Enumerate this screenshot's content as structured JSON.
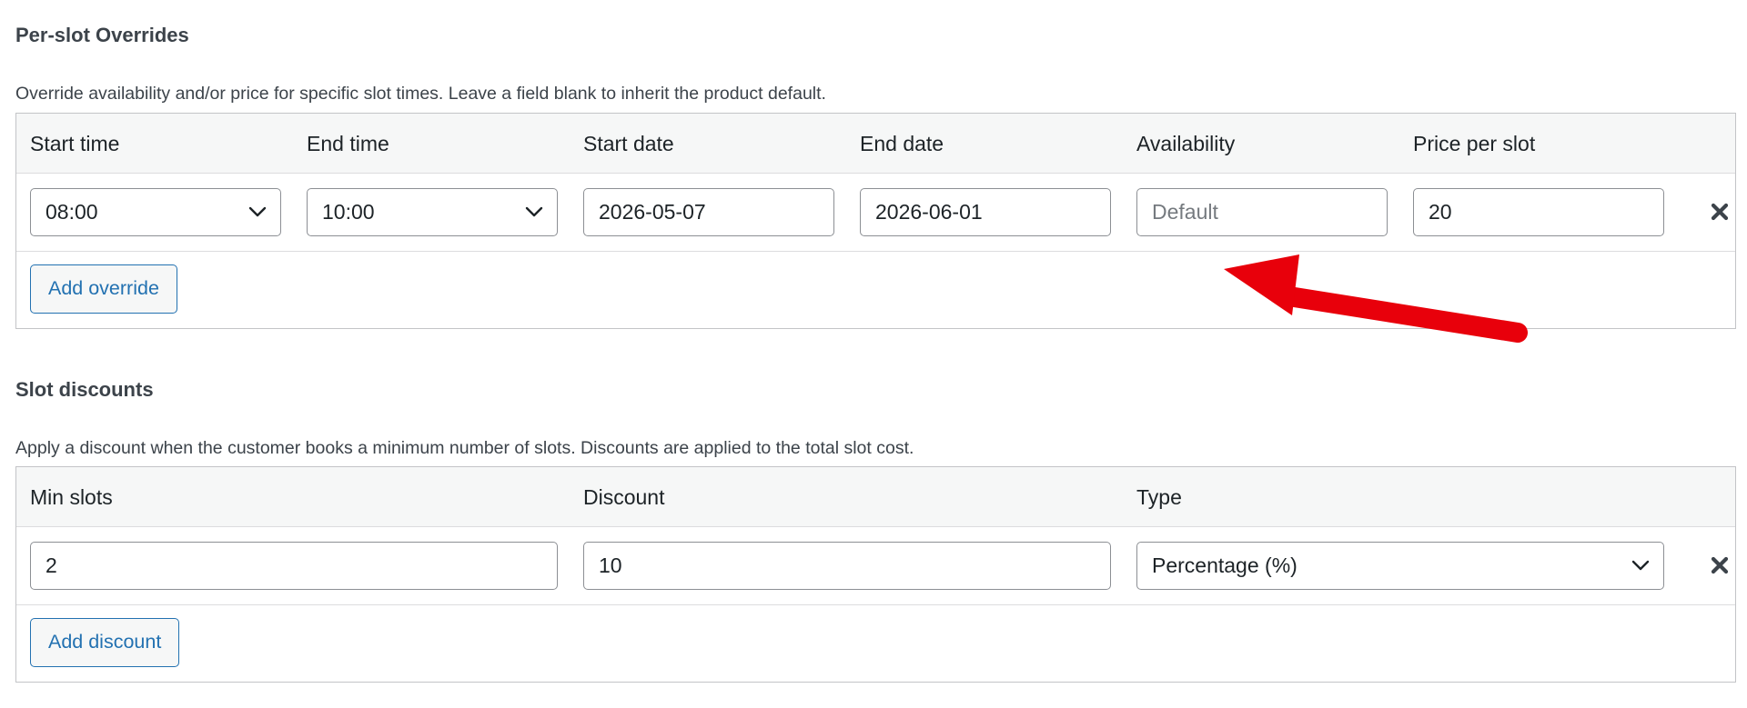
{
  "overrides": {
    "title": "Per-slot Overrides",
    "description": "Override availability and/or price for specific slot times. Leave a field blank to inherit the product default.",
    "columns": [
      "Start time",
      "End time",
      "Start date",
      "End date",
      "Availability",
      "Price per slot"
    ],
    "row": {
      "start_time": "08:00",
      "end_time": "10:00",
      "start_date": "2026-05-07",
      "end_date": "2026-06-01",
      "availability_value": "",
      "availability_placeholder": "Default",
      "price": "20"
    },
    "add_button": "Add override"
  },
  "discounts": {
    "title": "Slot discounts",
    "description": "Apply a discount when the customer books a minimum number of slots. Discounts are applied to the total slot cost.",
    "columns": [
      "Min slots",
      "Discount",
      "Type"
    ],
    "row": {
      "min_slots": "2",
      "discount": "10",
      "type": "Percentage (%)"
    },
    "add_button": "Add discount"
  },
  "icons": {
    "chevron": "chevron-down-icon",
    "remove": "close-icon",
    "annotation": "red-arrow-annotation"
  },
  "colors": {
    "accent": "#2271b1",
    "border": "#c3c4c7",
    "header_bg": "#f6f7f7",
    "annotation": "#e8000b"
  }
}
